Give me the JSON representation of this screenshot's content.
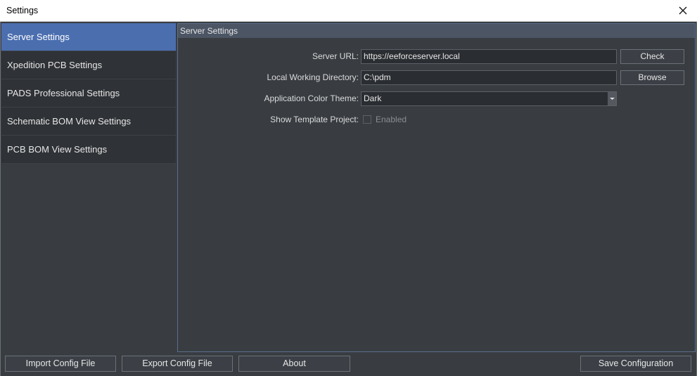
{
  "window": {
    "title": "Settings"
  },
  "sidebar": {
    "items": [
      {
        "label": "Server Settings"
      },
      {
        "label": "Xpedition PCB Settings"
      },
      {
        "label": "PADS Professional Settings"
      },
      {
        "label": "Schematic BOM View Settings"
      },
      {
        "label": "PCB BOM View Settings"
      }
    ]
  },
  "panel": {
    "header": "Server Settings",
    "server_url": {
      "label": "Server URL:",
      "value": "https://eeforceserver.local",
      "button": "Check"
    },
    "working_dir": {
      "label": "Local Working Directory:",
      "value": "C:\\pdm",
      "button": "Browse"
    },
    "color_theme": {
      "label": "Application Color Theme:",
      "value": "Dark"
    },
    "template_project": {
      "label": "Show Template Project:",
      "checkbox_label": "Enabled"
    }
  },
  "footer": {
    "import_label": "Import Config File",
    "export_label": "Export Config File",
    "about_label": "About",
    "save_label": "Save Configuration"
  }
}
